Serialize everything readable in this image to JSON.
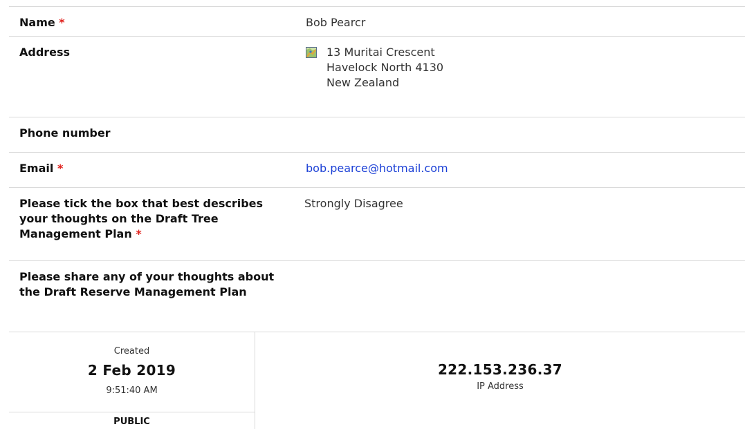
{
  "fields": [
    {
      "label": "Name",
      "required": true,
      "value": "Bob  Pearcr"
    },
    {
      "label": "Address",
      "required": false,
      "address_lines": [
        "13 Muritai Crescent",
        "Havelock North 4130",
        "New Zealand"
      ]
    },
    {
      "label": "Phone number",
      "required": false,
      "value": ""
    },
    {
      "label": "Email",
      "required": true,
      "value": "bob.pearce@hotmail.com"
    },
    {
      "label": "Please tick the box that best describes your thoughts on the Draft Tree Management Plan",
      "required": true,
      "value": "Strongly Disagree"
    },
    {
      "label": "Please share any of your thoughts about the Draft Reserve Management Plan",
      "required": false,
      "value": ""
    }
  ],
  "required_marker": "*",
  "meta": {
    "created_label": "Created",
    "created_date": "2 Feb 2019",
    "created_time": "9:51:40 AM",
    "visibility": "PUBLIC",
    "ip_value": "222.153.236.37",
    "ip_label": "IP Address"
  },
  "colors": {
    "required": "#e0201c",
    "link": "#1a3fd6",
    "divider": "#d9d9d9"
  },
  "icons": {
    "address": "map-icon"
  }
}
